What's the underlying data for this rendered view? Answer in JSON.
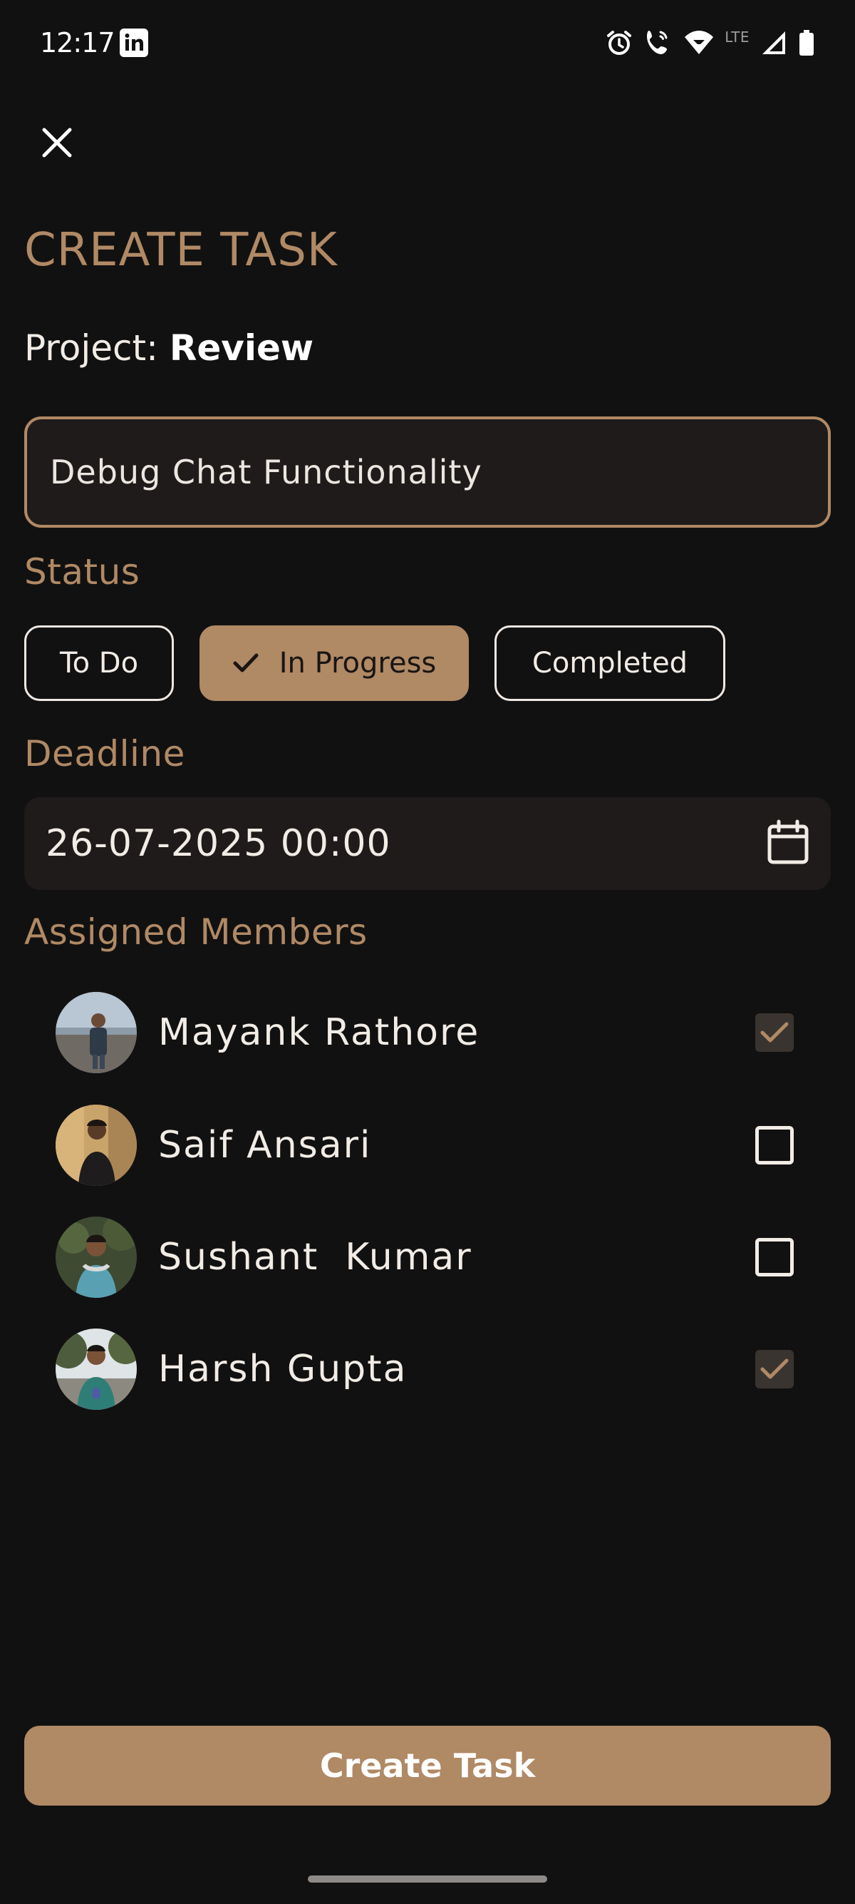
{
  "status_bar": {
    "time": "12:17",
    "network": "LTE",
    "icons": [
      "linkedin-icon",
      "alarm-icon",
      "wifi-calling-icon",
      "wifi-icon",
      "signal-icon",
      "battery-icon"
    ]
  },
  "header": {
    "close_icon": "close-icon",
    "title": "CREATE TASK",
    "project_prefix": "Project: ",
    "project_name": "Review"
  },
  "form": {
    "task_name": "Debug Chat Functionality",
    "status_label": "Status",
    "status_options": [
      {
        "label": "To Do",
        "selected": false
      },
      {
        "label": "In Progress",
        "selected": true
      },
      {
        "label": "Completed",
        "selected": false
      }
    ],
    "deadline_label": "Deadline",
    "deadline_value": "26-07-2025 00:00",
    "deadline_icon": "calendar-icon",
    "members_label": "Assigned Members",
    "members": [
      {
        "name": "Mayank Rathore",
        "checked": true
      },
      {
        "name": "Saif Ansari",
        "checked": false
      },
      {
        "name": "Sushant  Kumar",
        "checked": false
      },
      {
        "name": "Harsh Gupta",
        "checked": true
      }
    ]
  },
  "actions": {
    "create_label": "Create Task"
  },
  "colors": {
    "background": "#121111",
    "accent": "#b08965",
    "field_bg": "#1e1b1a",
    "text": "#f2ece6"
  }
}
